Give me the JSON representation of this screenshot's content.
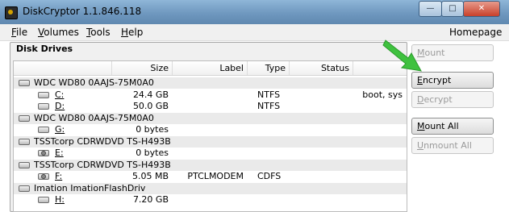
{
  "window": {
    "title": "DiskCryptor 1.1.846.118",
    "minimize": "—",
    "maximize": "□",
    "close": "✕"
  },
  "menu": [
    {
      "key": "F",
      "rest": "ile"
    },
    {
      "key": "V",
      "rest": "olumes"
    },
    {
      "key": "T",
      "rest": "ools"
    },
    {
      "key": "H",
      "rest": "elp"
    }
  ],
  "homepage": "Homepage",
  "group_title": "Disk Drives",
  "columns": {
    "size": "Size",
    "label": "Label",
    "type": "Type",
    "status": "Status"
  },
  "rows": [
    {
      "kind": "disk",
      "name": "WDC WD80 0AAJS-75M0A0"
    },
    {
      "kind": "part",
      "icon": "hdd-icon",
      "drive": "C:",
      "size": "24.4 GB",
      "label": "",
      "type": "NTFS",
      "status": "boot, sys"
    },
    {
      "kind": "part",
      "icon": "hdd-icon",
      "drive": "D:",
      "size": "50.0 GB",
      "label": "",
      "type": "NTFS",
      "status": ""
    },
    {
      "kind": "disk",
      "name": "WDC WD80 0AAJS-75M0A0"
    },
    {
      "kind": "part",
      "icon": "hdd-icon",
      "drive": "G:",
      "size": "0 bytes",
      "label": "",
      "type": "",
      "status": ""
    },
    {
      "kind": "disk",
      "name": "TSSTcorp CDRWDVD TS-H493B"
    },
    {
      "kind": "part",
      "icon": "cdrom-icon",
      "drive": "E:",
      "size": "0 bytes",
      "label": "",
      "type": "",
      "status": ""
    },
    {
      "kind": "disk",
      "name": "TSSTcorp CDRWDVD TS-H493B"
    },
    {
      "kind": "part",
      "icon": "cdrom-icon",
      "drive": "F:",
      "size": "5.05 MB",
      "label": "PTCLMODEM",
      "type": "CDFS",
      "status": ""
    },
    {
      "kind": "disk",
      "name": "Imation ImationFlashDriv"
    },
    {
      "kind": "part",
      "icon": "hdd-icon",
      "drive": "H:",
      "size": "7.20 GB",
      "label": "",
      "type": "",
      "status": ""
    }
  ],
  "buttons": {
    "mount": {
      "key": "M",
      "rest": "ount"
    },
    "encrypt": {
      "key": "E",
      "rest": "ncrypt"
    },
    "decrypt": {
      "key": "D",
      "rest": "ecrypt"
    },
    "mount_all": {
      "key": "M",
      "rest": "ount All"
    },
    "unmount_all": {
      "key": "U",
      "rest": "nmount All"
    }
  },
  "colors": {
    "accent_arrow": "#3ec13e",
    "titlebar": "#7ea6cb"
  }
}
